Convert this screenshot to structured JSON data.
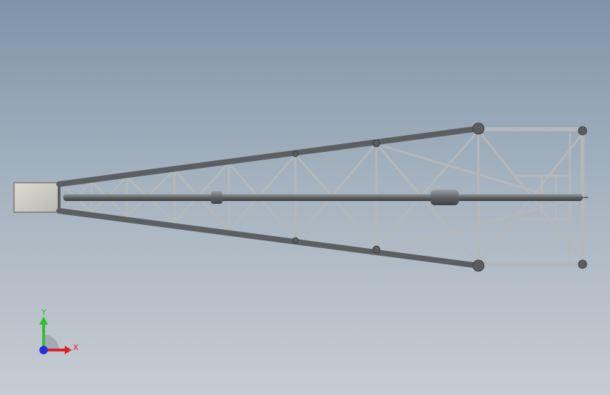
{
  "viewport": {
    "background_top": "#7f93a8",
    "background_bottom": "#c7ccd2"
  },
  "model": {
    "description_icon": "lattice-boom-truss",
    "tube_color": "#6f7275",
    "brace_color": "#a7abae",
    "end_plate_color": "#cfcfc7"
  },
  "triad": {
    "y_label": "Y",
    "x_label": "X",
    "y_color": "#2fbf2f",
    "x_color": "#e02020",
    "z_color": "#2030e0"
  }
}
